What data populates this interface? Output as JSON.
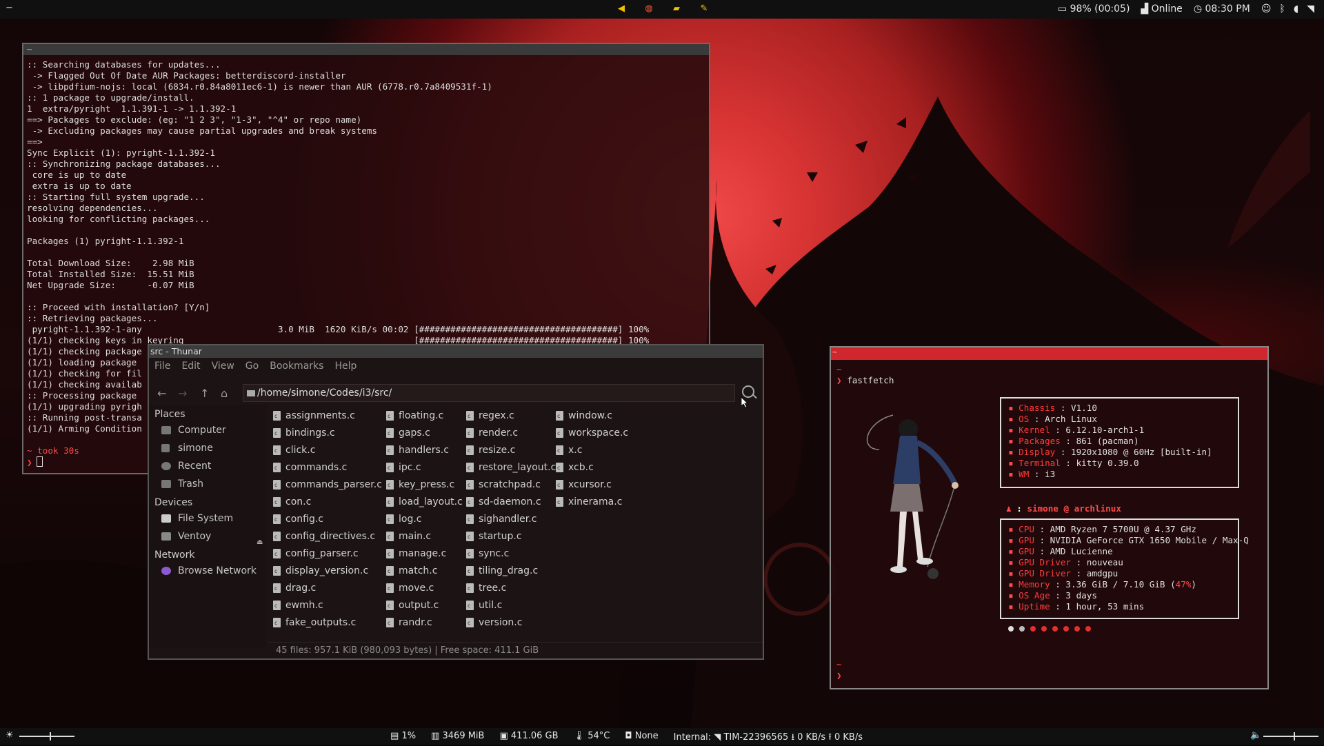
{
  "topbar": {
    "workspace": "−",
    "battery": "98% (00:05)",
    "network": "Online",
    "clock": "08:30 PM",
    "app_icons": [
      "vscode-icon",
      "browser-icon",
      "folder-icon",
      "notes-icon"
    ]
  },
  "terminal": {
    "title": "~",
    "lines": [
      ":: Searching databases for updates...",
      " -> Flagged Out Of Date AUR Packages: betterdiscord-installer",
      " -> libpdfium-nojs: local (6834.r0.84a8011ec6-1) is newer than AUR (6778.r0.7a8409531f-1)",
      ":: 1 package to upgrade/install.",
      "1  extra/pyright  1.1.391-1 -> 1.1.392-1",
      "==> Packages to exclude: (eg: \"1 2 3\", \"1-3\", \"^4\" or repo name)",
      " -> Excluding packages may cause partial upgrades and break systems",
      "==>",
      "Sync Explicit (1): pyright-1.1.392-1",
      ":: Synchronizing package databases...",
      " core is up to date",
      " extra is up to date",
      ":: Starting full system upgrade...",
      "resolving dependencies...",
      "looking for conflicting packages...",
      "",
      "Packages (1) pyright-1.1.392-1",
      "",
      "Total Download Size:    2.98 MiB",
      "Total Installed Size:  15.51 MiB",
      "Net Upgrade Size:      -0.07 MiB",
      "",
      ":: Proceed with installation? [Y/n]",
      ":: Retrieving packages...",
      " pyright-1.1.392-1-any                          3.0 MiB  1620 KiB/s 00:02 [######################################] 100%",
      "(1/1) checking keys in keyring                                            [######################################] 100%",
      "(1/1) checking package",
      "(1/1) loading package",
      "(1/1) checking for fil",
      "(1/1) checking availab",
      ":: Processing package",
      "(1/1) upgrading pyrigh",
      ":: Running post-transa",
      "(1/1) Arming Condition",
      ""
    ],
    "took_prefix": "~ took ",
    "took_value": "30s",
    "prompt": "❯"
  },
  "thunar": {
    "title": "src - Thunar",
    "menu": [
      "File",
      "Edit",
      "View",
      "Go",
      "Bookmarks",
      "Help"
    ],
    "path": "/home/simone/Codes/i3/src/",
    "places_header": "Places",
    "places": [
      "Computer",
      "simone",
      "Recent",
      "Trash"
    ],
    "devices_header": "Devices",
    "devices": [
      "File System",
      "Ventoy"
    ],
    "network_header": "Network",
    "network": [
      "Browse Network"
    ],
    "columns": [
      [
        "assignments.c",
        "bindings.c",
        "click.c",
        "commands.c",
        "commands_parser.c",
        "con.c",
        "config.c",
        "config_directives.c",
        "config_parser.c",
        "display_version.c",
        "drag.c",
        "ewmh.c",
        "fake_outputs.c"
      ],
      [
        "floating.c",
        "gaps.c",
        "handlers.c",
        "ipc.c",
        "key_press.c",
        "load_layout.c",
        "log.c",
        "main.c",
        "manage.c",
        "match.c",
        "move.c",
        "output.c",
        "randr.c"
      ],
      [
        "regex.c",
        "render.c",
        "resize.c",
        "restore_layout.c",
        "scratchpad.c",
        "sd-daemon.c",
        "sighandler.c",
        "startup.c",
        "sync.c",
        "tiling_drag.c",
        "tree.c",
        "util.c",
        "version.c"
      ],
      [
        "window.c",
        "workspace.c",
        "x.c",
        "xcb.c",
        "xcursor.c",
        "xinerama.c"
      ]
    ],
    "status": "45 files: 957.1 KiB (980,093 bytes)  |  Free space: 411.1 GiB"
  },
  "fastfetch": {
    "title": "~",
    "prompt_symbol": "~",
    "command": "fastfetch",
    "system": [
      {
        "key": "Chassis",
        "value": "V1.10"
      },
      {
        "key": "OS",
        "value": "Arch Linux"
      },
      {
        "key": "Kernel",
        "value": "6.12.10-arch1-1"
      },
      {
        "key": "Packages",
        "value": "861 (pacman)"
      },
      {
        "key": "Display",
        "value": "1920x1080 @ 60Hz [built-in]"
      },
      {
        "key": "Terminal",
        "value": "kitty 0.39.0"
      },
      {
        "key": "WM",
        "value": "i3"
      }
    ],
    "user": "simone",
    "host": "archlinux",
    "hardware": [
      {
        "key": "CPU",
        "value": "AMD Ryzen 7 5700U @ 4.37 GHz"
      },
      {
        "key": "GPU",
        "value": "NVIDIA GeForce GTX 1650 Mobile / Max-Q"
      },
      {
        "key": "GPU",
        "value": "AMD Lucienne"
      },
      {
        "key": "GPU Driver",
        "value": "nouveau"
      },
      {
        "key": "GPU Driver",
        "value": "amdgpu"
      },
      {
        "key": "Memory",
        "value": "3.36 GiB / 7.10 GiB (",
        "extra": "47%",
        "tail": ")"
      },
      {
        "key": "OS Age",
        "value": "3 days"
      },
      {
        "key": "Uptime",
        "value": "1 hour, 53 mins"
      }
    ],
    "color_dots": [
      "#dddddd",
      "#bbbbbb",
      "#e03030",
      "#e03030",
      "#e03030",
      "#e03030",
      "#e03030",
      "#e03030"
    ]
  },
  "bottombar": {
    "cpu": "1%",
    "memory": "3469 MiB",
    "disk": "411.06 GB",
    "temp": "54°C",
    "media": "None",
    "network_label": "Internal:",
    "ssid": "TIM-22396565",
    "down": "0 KB/s",
    "up": "0 KB/s",
    "brightness_level": 0.55,
    "volume_level": 0.55
  },
  "colors": {
    "accent": "#d0262e",
    "key": "#ff3c3c"
  }
}
